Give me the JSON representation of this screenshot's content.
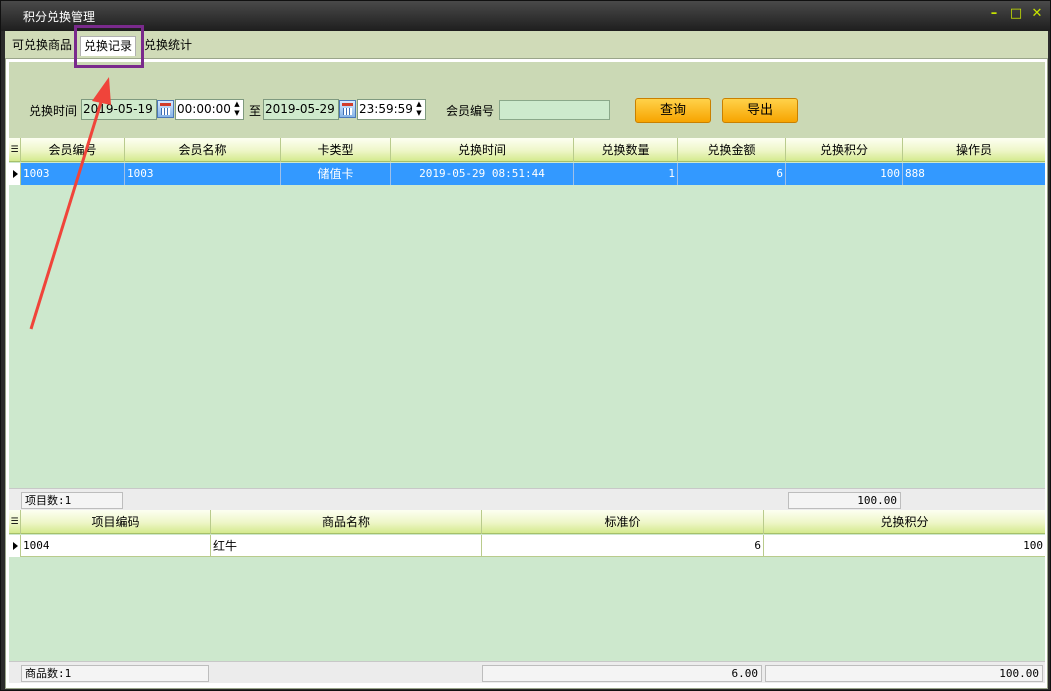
{
  "window": {
    "title": "积分兑换管理",
    "controls": {
      "minimize": "–",
      "maximize": "□",
      "close": "✕"
    }
  },
  "tabs": [
    {
      "label": "可兑换商品"
    },
    {
      "label": "兑换记录",
      "active": true
    },
    {
      "label": "兑换统计"
    }
  ],
  "filter": {
    "time_label": "兑换时间",
    "start_date": "2019-05-19",
    "start_time": "00:00:00",
    "to_label": "至",
    "end_date": "2019-05-29",
    "end_time": "23:59:59",
    "member_label": "会员编号",
    "member_value": "",
    "query_button": "查询",
    "export_button": "导出"
  },
  "records_table": {
    "columns": [
      "会员编号",
      "会员名称",
      "卡类型",
      "兑换时间",
      "兑换数量",
      "兑换金额",
      "兑换积分",
      "操作员"
    ],
    "rows": [
      [
        "1003",
        "1003",
        "储值卡",
        "2019-05-29 08:51:44",
        "1",
        "6",
        "100",
        "888"
      ]
    ],
    "footer_count": "项目数:1",
    "footer_total": "100.00"
  },
  "items_table": {
    "columns": [
      "项目编码",
      "商品名称",
      "标准价",
      "兑换积分"
    ],
    "rows": [
      [
        "1004",
        "红牛",
        "6",
        "100"
      ]
    ],
    "footer_count": "商品数:1",
    "footer_price": "6.00",
    "footer_points": "100.00"
  },
  "colors": {
    "selected_row": "#3399ff",
    "annotation_box": "#7a2a8c",
    "annotation_arrow": "#f0443a",
    "button": "#f7a400"
  },
  "icons": [
    "calendar-icon",
    "spin-up-icon",
    "spin-down-icon",
    "row-indicator-icon"
  ]
}
